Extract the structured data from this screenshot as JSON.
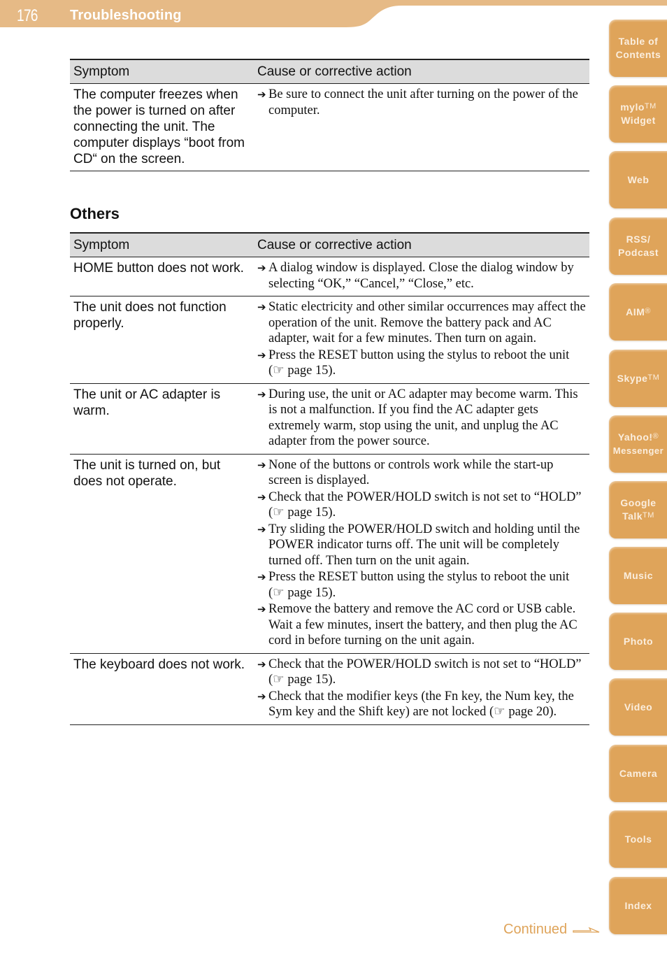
{
  "header": {
    "page_number": "176",
    "title": "Troubleshooting",
    "band_color": "#e6ba86"
  },
  "side_tabs": [
    {
      "label": "Table of Contents",
      "line1": "Table of",
      "line2": "Contents",
      "mark": ""
    },
    {
      "label": "mylo Widget",
      "line1": "mylo",
      "line2": "Widget",
      "mark": "TM"
    },
    {
      "label": "Web",
      "line1": "Web",
      "line2": "",
      "mark": ""
    },
    {
      "label": "RSS/ Podcast",
      "line1": "RSS/",
      "line2": "Podcast",
      "mark": ""
    },
    {
      "label": "AIM",
      "line1": "AIM",
      "line2": "",
      "mark": "®"
    },
    {
      "label": "Skype",
      "line1": "Skype",
      "line2": "",
      "mark": "TM"
    },
    {
      "label": "Yahoo! Messenger",
      "line1": "Yahoo!",
      "line2": "Messenger",
      "mark": "®"
    },
    {
      "label": "Google Talk",
      "line1": "Google",
      "line2": "Talk",
      "mark": "TM"
    },
    {
      "label": "Music",
      "line1": "Music",
      "line2": "",
      "mark": ""
    },
    {
      "label": "Photo",
      "line1": "Photo",
      "line2": "",
      "mark": ""
    },
    {
      "label": "Video",
      "line1": "Video",
      "line2": "",
      "mark": ""
    },
    {
      "label": "Camera",
      "line1": "Camera",
      "line2": "",
      "mark": ""
    },
    {
      "label": "Tools",
      "line1": "Tools",
      "line2": "",
      "mark": ""
    },
    {
      "label": "Index",
      "line1": "Index",
      "line2": "",
      "mark": ""
    }
  ],
  "accent_color": "#dfa45a",
  "table1": {
    "headers": [
      "Symptom",
      "Cause or corrective action"
    ],
    "rows": [
      {
        "symptom": "The computer freezes when the power is turned on after connecting the unit. The computer displays “boot from CD“ on the screen.",
        "actions": [
          "Be sure to connect the unit after turning on the power of the computer."
        ]
      }
    ]
  },
  "section": {
    "title": "Others"
  },
  "table2": {
    "headers": [
      "Symptom",
      "Cause or corrective action"
    ],
    "rows": [
      {
        "symptom": "HOME button does not work.",
        "actions": [
          "A dialog window is displayed. Close the dialog window by selecting “OK,” “Cancel,” “Close,” etc."
        ]
      },
      {
        "symptom": "The unit does not function properly.",
        "actions": [
          "Static electricity and other similar occurrences may affect the operation of the unit. Remove the battery pack and AC adapter, wait for a few minutes. Then turn on again.",
          "Press the RESET button using the stylus to reboot the unit (☞ page 15)."
        ]
      },
      {
        "symptom": "The unit or AC adapter is warm.",
        "actions": [
          "During use, the unit or AC adapter may become warm. This is not a malfunction. If you find the AC adapter gets extremely warm, stop using the unit, and unplug the AC adapter from the power source."
        ]
      },
      {
        "symptom": "The unit is turned on, but does not operate.",
        "actions": [
          "None of the buttons or controls work while the start-up screen is displayed.",
          "Check that the POWER/HOLD switch is not set to “HOLD” (☞ page 15).",
          "Try sliding the POWER/HOLD switch and holding until the POWER indicator turns off. The unit will be completely turned off. Then turn on the unit again.",
          "Press the RESET button using the stylus to reboot the unit (☞ page 15).",
          "Remove the battery and remove the AC cord or USB cable. Wait a few minutes, insert the battery, and then plug the AC cord in before turning on the unit again."
        ]
      },
      {
        "symptom": "The keyboard does not work.",
        "actions": [
          "Check that the POWER/HOLD switch is not set to “HOLD” (☞ page 15).",
          "Check that the modifier keys (the Fn key, the Num key, the Sym key and the Shift key) are not locked (☞ page 20)."
        ]
      }
    ]
  },
  "footer": {
    "continued_label": "Continued",
    "continued_icon": "arrow-right-outline-icon"
  }
}
